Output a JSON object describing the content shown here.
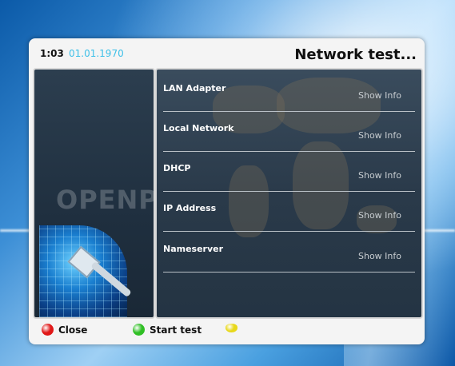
{
  "header": {
    "time": "1:03",
    "date": "01.01.1970",
    "title": "Network test..."
  },
  "logo": {
    "text": "OPENPLi"
  },
  "tests": [
    {
      "label": "LAN Adapter",
      "status": "Show Info"
    },
    {
      "label": "Local Network",
      "status": "Show Info"
    },
    {
      "label": "DHCP",
      "status": "Show Info"
    },
    {
      "label": "IP Address",
      "status": "Show Info"
    },
    {
      "label": "Nameserver",
      "status": "Show Info"
    }
  ],
  "buttons": {
    "red": {
      "label": "Close",
      "color": "#e01818"
    },
    "green": {
      "label": "Start test",
      "color": "#2fbf24"
    },
    "yellow": {
      "label": "",
      "color": "#e8d81a"
    }
  },
  "colors": {
    "accent_date": "#3fc0e8"
  }
}
